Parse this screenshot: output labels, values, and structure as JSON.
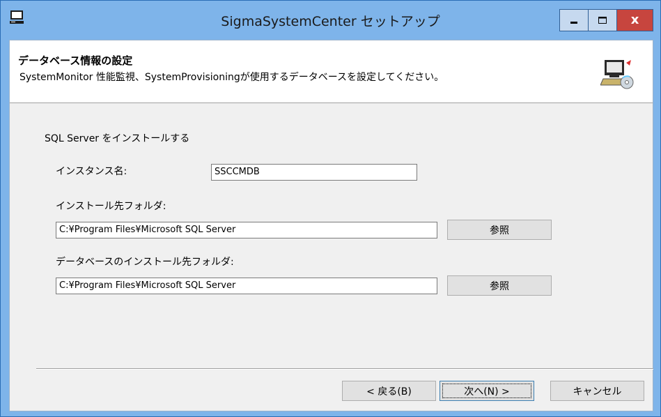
{
  "window": {
    "title": "SigmaSystemCenter セットアップ",
    "close_glyph": "x"
  },
  "header": {
    "title": "データベース情報の設定",
    "description": "SystemMonitor 性能監視、SystemProvisioningが使用するデータベースを設定してください。",
    "icon": "computer-cd-icon"
  },
  "form": {
    "section_label": "SQL Server をインストールする",
    "instance_name_label": "インスタンス名:",
    "instance_name_value": "SSCCMDB",
    "install_folder_label": "インストール先フォルダ:",
    "install_folder_value": "C:¥Program Files¥Microsoft SQL Server",
    "install_folder_browse": "参照",
    "db_folder_label": "データベースのインストール先フォルダ:",
    "db_folder_value": "C:¥Program Files¥Microsoft SQL Server",
    "db_folder_browse": "参照"
  },
  "buttons": {
    "back": "< 戻る(B)",
    "next": "次へ(N) >",
    "cancel": "キャンセル"
  },
  "colors": {
    "titlebar": "#7eb4ea",
    "close_button": "#c7453e",
    "client_bg": "#f0f0f0"
  }
}
